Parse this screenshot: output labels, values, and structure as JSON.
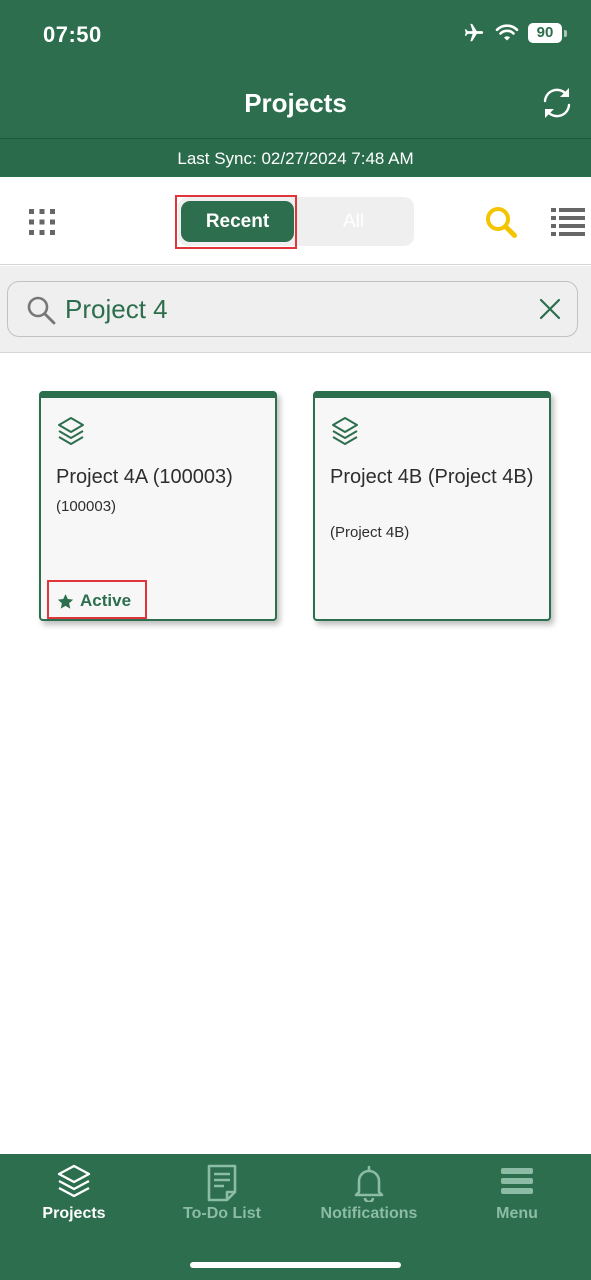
{
  "status_bar": {
    "time": "07:50",
    "battery": "90",
    "icons": [
      "airplane-icon",
      "wifi-icon",
      "battery-icon"
    ]
  },
  "header": {
    "title": "Projects",
    "sync_icon": "sync-icon",
    "last_sync": "Last Sync: 02/27/2024 7:48 AM"
  },
  "toolbar": {
    "grid_icon": "grid-icon",
    "segments": [
      {
        "label": "Recent",
        "selected": true
      },
      {
        "label": "All",
        "selected": false
      }
    ],
    "search_icon": "search-icon",
    "list_icon": "list-view-icon"
  },
  "search": {
    "value": "Project 4",
    "placeholder": "",
    "clear_icon": "clear-icon"
  },
  "projects": [
    {
      "title": "Project 4A (100003)",
      "subtitle": "(100003)",
      "status": "Active",
      "icon": "layers-icon"
    },
    {
      "title": "Project 4B (Project 4B)",
      "subtitle": "(Project 4B)",
      "status": "",
      "icon": "layers-icon"
    }
  ],
  "tabbar": {
    "tabs": [
      {
        "label": "Projects",
        "icon": "layers-icon",
        "active": true
      },
      {
        "label": "To-Do List",
        "icon": "todo-list-icon",
        "active": false
      },
      {
        "label": "Notifications",
        "icon": "bell-icon",
        "active": false
      },
      {
        "label": "Menu",
        "icon": "menu-icon",
        "active": false
      }
    ]
  },
  "colors": {
    "brand_green": "#2c6e4e",
    "search_accent": "#f5c400",
    "highlight": "#e0353b",
    "inactive_tab": "#8cbca5"
  }
}
